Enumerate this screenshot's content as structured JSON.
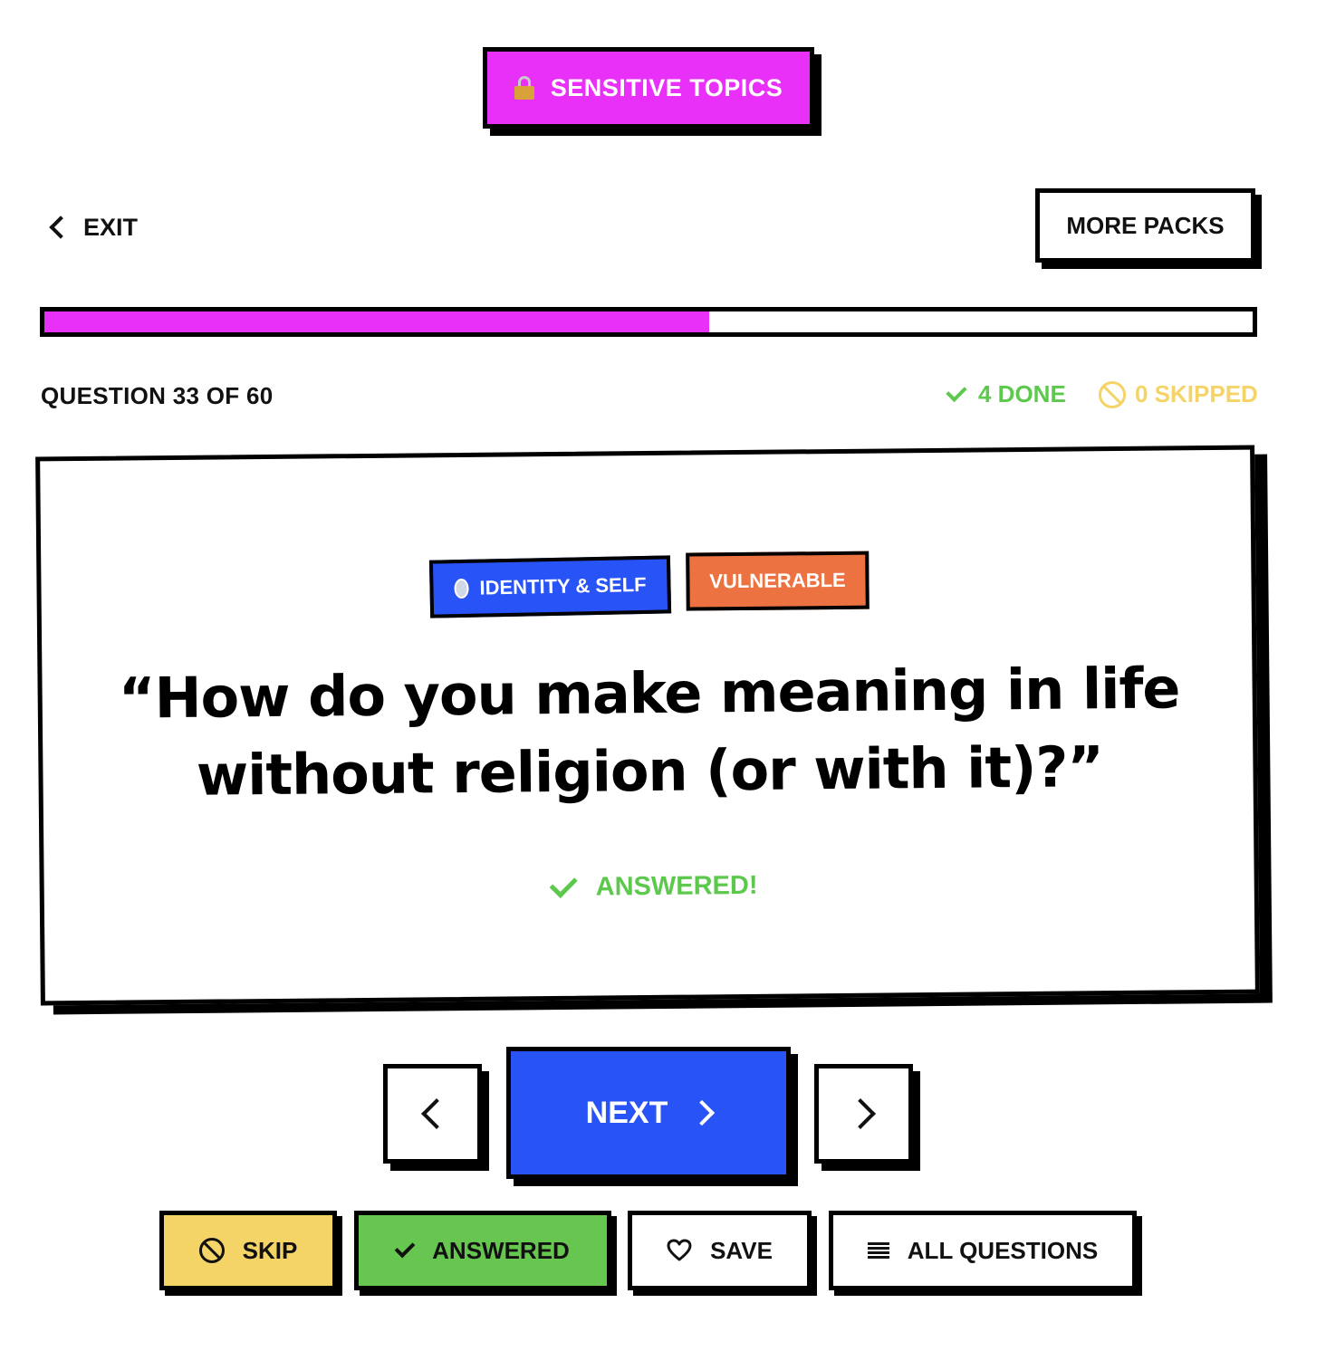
{
  "pack": {
    "label": "SENSITIVE TOPICS",
    "icon": "lock-icon",
    "color": "#e930f8"
  },
  "header": {
    "exit_label": "EXIT",
    "more_packs_label": "MORE PACKS"
  },
  "progress": {
    "fraction": 0.55
  },
  "counter": {
    "label": "QUESTION 33 OF 60"
  },
  "stats": {
    "done_label": "4 DONE",
    "skipped_label": "0 SKIPPED",
    "done_color": "#5cc94d",
    "skipped_color": "#f5d467"
  },
  "card": {
    "tags": [
      {
        "label": "IDENTITY & SELF",
        "icon": "gem-icon",
        "color": "#2853f6"
      },
      {
        "label": "VULNERABLE",
        "color": "#ec7241"
      }
    ],
    "question": "“How do you make meaning in life without religion (or with it)?”",
    "status": "ANSWERED!"
  },
  "nav": {
    "next_label": "NEXT",
    "next_color": "#2853f6"
  },
  "actions": {
    "skip_label": "SKIP",
    "answered_label": "ANSWERED",
    "save_label": "SAVE",
    "all_label": "ALL QUESTIONS"
  }
}
